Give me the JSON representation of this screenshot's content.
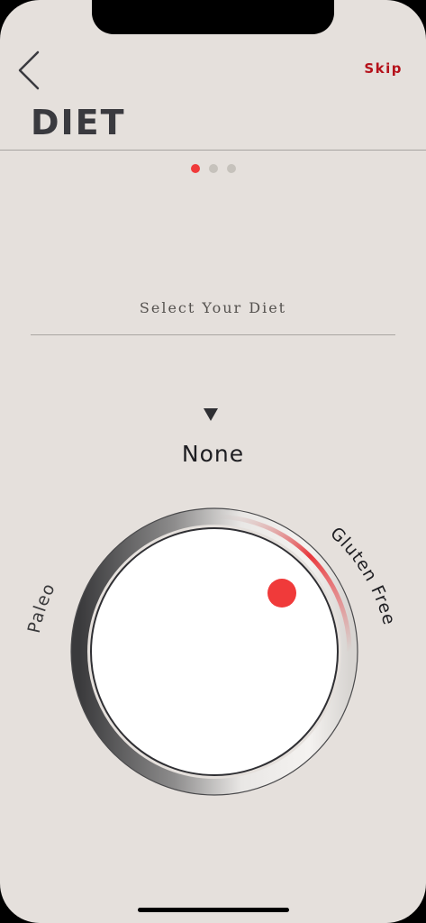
{
  "header": {
    "back_icon": "chevron-left-icon",
    "skip_label": "Skip",
    "title": "DIET"
  },
  "pagination": {
    "total": 3,
    "current": 1
  },
  "selector": {
    "prompt": "Select Your Diet",
    "selected": "None",
    "options": [
      "Paleo",
      "None",
      "Gluten Free"
    ]
  },
  "colors": {
    "accent": "#e8383d",
    "skip": "#b5121b",
    "background": "#e5e0dc"
  }
}
